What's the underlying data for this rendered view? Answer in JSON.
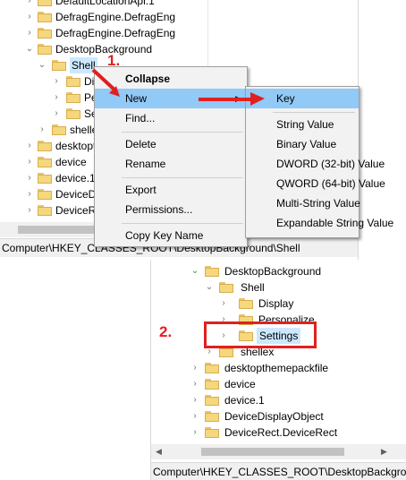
{
  "top_tree": {
    "items": [
      {
        "label": "DefaultLocationApi.1",
        "expander": "›"
      },
      {
        "label": "DefragEngine.DefragEng",
        "expander": "›"
      },
      {
        "label": "DefragEngine.DefragEng",
        "expander": "›"
      },
      {
        "label": "DesktopBackground",
        "expander": "⌄"
      },
      {
        "label": "Shell",
        "expander": "⌄"
      },
      {
        "label": "Display",
        "expander": "›"
      },
      {
        "label": "Personalize",
        "expander": "›"
      },
      {
        "label": "Settings",
        "expander": "›"
      },
      {
        "label": "shellex",
        "expander": "›"
      },
      {
        "label": "desktopthemepackfile",
        "expander": "›"
      },
      {
        "label": "device",
        "expander": "›"
      },
      {
        "label": "device.1",
        "expander": "›"
      },
      {
        "label": "DeviceDisplayObject",
        "expander": "›"
      },
      {
        "label": "DeviceRect.DeviceRect",
        "expander": "›"
      }
    ],
    "status": "Computer\\HKEY_CLASSES_ROOT\\DesktopBackground\\Shell"
  },
  "context_menu": {
    "items": [
      "Collapse",
      "New",
      "Find...",
      "Delete",
      "Rename",
      "Export",
      "Permissions...",
      "Copy Key Name"
    ]
  },
  "submenu": {
    "items": [
      "Key",
      "String Value",
      "Binary Value",
      "DWORD (32-bit) Value",
      "QWORD (64-bit) Value",
      "Multi-String Value",
      "Expandable String Value"
    ]
  },
  "bottom_tree": {
    "items": [
      {
        "label": "DesktopBackground",
        "expander": "⌄"
      },
      {
        "label": "Shell",
        "expander": "⌄"
      },
      {
        "label": "Display",
        "expander": "›"
      },
      {
        "label": "Personalize",
        "expander": "›"
      },
      {
        "label": "Settings",
        "expander": "›"
      },
      {
        "label": "shellex",
        "expander": "›"
      },
      {
        "label": "desktopthemepackfile",
        "expander": "›"
      },
      {
        "label": "device",
        "expander": "›"
      },
      {
        "label": "device.1",
        "expander": "›"
      },
      {
        "label": "DeviceDisplayObject",
        "expander": "›"
      },
      {
        "label": "DeviceRect.DeviceRect",
        "expander": "›"
      }
    ],
    "status": "Computer\\HKEY_CLASSES_ROOT\\DesktopBackground\\Shell"
  },
  "annotations": {
    "step1": "1.",
    "step2": "2."
  },
  "colors": {
    "highlight": "#91c9f7",
    "annotation_red": "#e02020",
    "folder": "#f5d77d"
  }
}
